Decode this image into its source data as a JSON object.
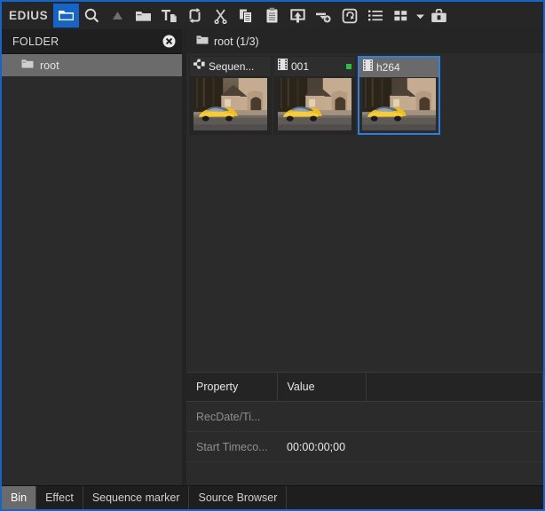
{
  "window": {
    "brand": "EDIUS",
    "accent_blue": "#1565c9",
    "selection_blue": "#2a7fe0",
    "panel_bg": "#2b2b2b",
    "focus_border": "#1565c9"
  },
  "toolbar": {
    "buttons": [
      {
        "icon": "folder-open-icon",
        "label": "Bin",
        "active": true
      },
      {
        "icon": "search-icon",
        "label": "Search",
        "active": false
      },
      {
        "icon": "triangle-up-icon",
        "label": "Up One Level",
        "active": false
      },
      {
        "icon": "folder-icon",
        "label": "Open Folder",
        "active": false
      },
      {
        "icon": "new-title-icon",
        "label": "Add Title Clip",
        "active": false
      },
      {
        "icon": "transfer-loop-icon",
        "label": "Transfer",
        "active": false
      },
      {
        "icon": "scissors-icon",
        "label": "Cut",
        "active": false
      },
      {
        "icon": "copy-icon",
        "label": "Copy",
        "active": false
      },
      {
        "icon": "clipboard-icon",
        "label": "Paste",
        "active": false
      },
      {
        "icon": "add-to-timeline-icon",
        "label": "Add To Timeline",
        "active": false
      },
      {
        "icon": "add-clip-icon",
        "label": "Add Clip",
        "active": false
      },
      {
        "icon": "restore-offline-icon",
        "label": "Restore Offline Clip",
        "active": false
      },
      {
        "icon": "list-view-icon",
        "label": "List View",
        "active": false
      },
      {
        "icon": "grid-view-icon",
        "label": "Thumbnail View",
        "active": false
      },
      {
        "icon": "chevron-down-icon",
        "label": "View Options",
        "active": false
      },
      {
        "icon": "toolbox-icon",
        "label": "Tool",
        "active": false
      }
    ]
  },
  "folder_panel": {
    "title": "FOLDER",
    "close_icon": "close-icon",
    "items": [
      {
        "label": "root",
        "icon": "folder-icon",
        "selected": true
      }
    ]
  },
  "bin": {
    "breadcrumb": {
      "icon": "folder-icon",
      "text": "root (1/3)"
    },
    "clips": [
      {
        "name": "Sequen...",
        "icon": "sequence-icon",
        "selected": false,
        "badge": null
      },
      {
        "name": "001",
        "icon": "film-icon",
        "selected": false,
        "badge": "#27c040"
      },
      {
        "name": "h264",
        "icon": "film-icon",
        "selected": true,
        "badge": null
      }
    ]
  },
  "properties": {
    "headers": [
      "Property",
      "Value",
      ""
    ],
    "rows": [
      {
        "property": "RecDate/Ti...",
        "value": ""
      },
      {
        "property": "Start Timeco...",
        "value": "00:00:00;00"
      }
    ]
  },
  "bottom_tabs": {
    "tabs": [
      {
        "label": "Bin",
        "active": true
      },
      {
        "label": "Effect",
        "active": false
      },
      {
        "label": "Sequence marker",
        "active": false
      },
      {
        "label": "Source Browser",
        "active": false
      }
    ]
  }
}
